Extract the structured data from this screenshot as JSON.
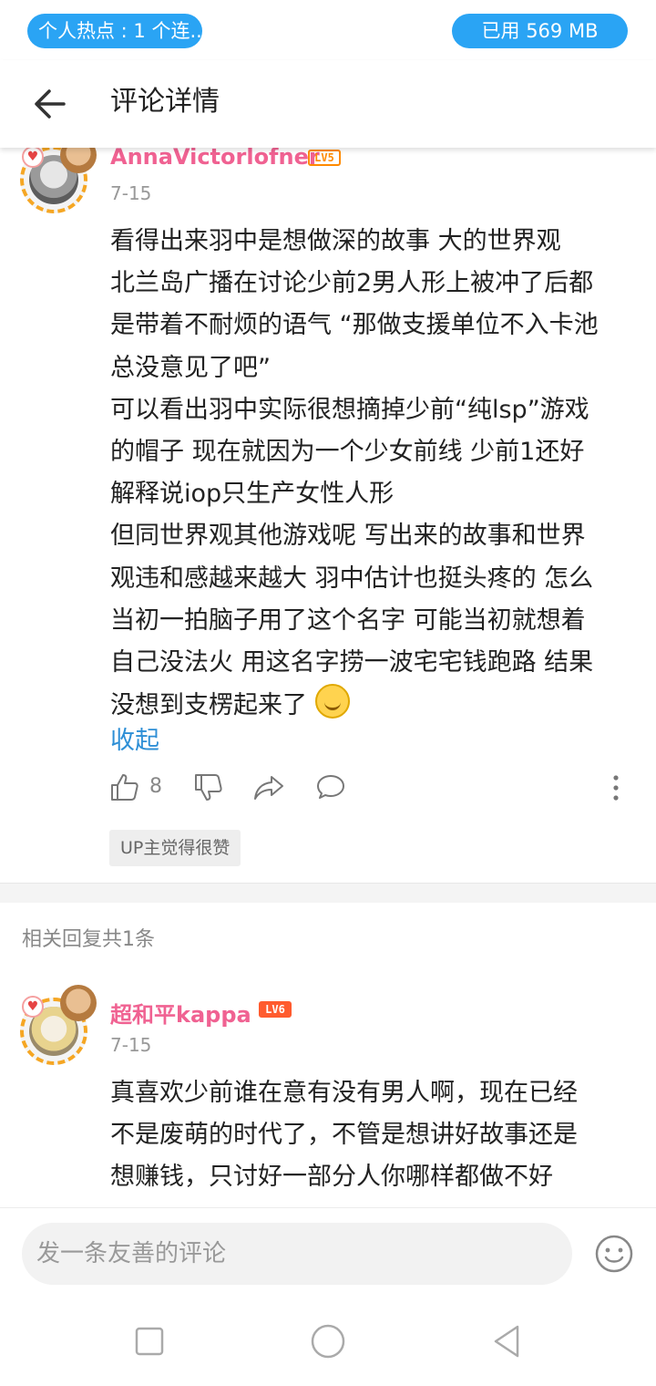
{
  "status_bar": {
    "left_pill": "个人热点 : 1 个连...",
    "right_pill": "已用 569 MB"
  },
  "header": {
    "title": "评论详情"
  },
  "comment": {
    "username": "AnnaVictorlofner",
    "level": "LV5",
    "date": "7-15",
    "lines": [
      "看得出来羽中是想做深的故事 大的世界观",
      "北兰岛广播在讨论少前2男人形上被冲了后都",
      "是带着不耐烦的语气 “那做支援单位不入卡池",
      "总没意见了吧”",
      "可以看出羽中实际很想摘掉少前“纯lsp”游戏",
      "的帽子 现在就因为一个少女前线 少前1还好",
      "解释说iop只生产女性人形",
      "但同世界观其他游戏呢   写出来的故事和世界",
      "观违和感越来越大 羽中估计也挺头疼的 怎么",
      "当初一拍脑子用了这个名字 可能当初就想着",
      "自己没法火 用这名字捞一波宅宅钱跑路 结果",
      "没想到支楞起来了"
    ],
    "emoji_icon": "laughing-crying-emoji",
    "collapse_label": "收起",
    "like_count": "8",
    "up_tag": "UP主觉得很赞"
  },
  "replies": {
    "count_label": "相关回复共1条",
    "items": [
      {
        "username": "超和平kappa",
        "level": "LV6",
        "date": "7-15",
        "lines": [
          "真喜欢少前谁在意有没有男人啊，现在已经",
          "不是废萌的时代了，不管是想讲好故事还是",
          "想赚钱，只讨好一部分人你哪样都做不好"
        ]
      }
    ]
  },
  "composer": {
    "placeholder": "发一条友善的评论"
  },
  "colors": {
    "accent_blue": "#2aa4f4",
    "username_pink": "#f06292",
    "link_blue": "#2e8fd6",
    "level_orange": "#ff8a00"
  }
}
